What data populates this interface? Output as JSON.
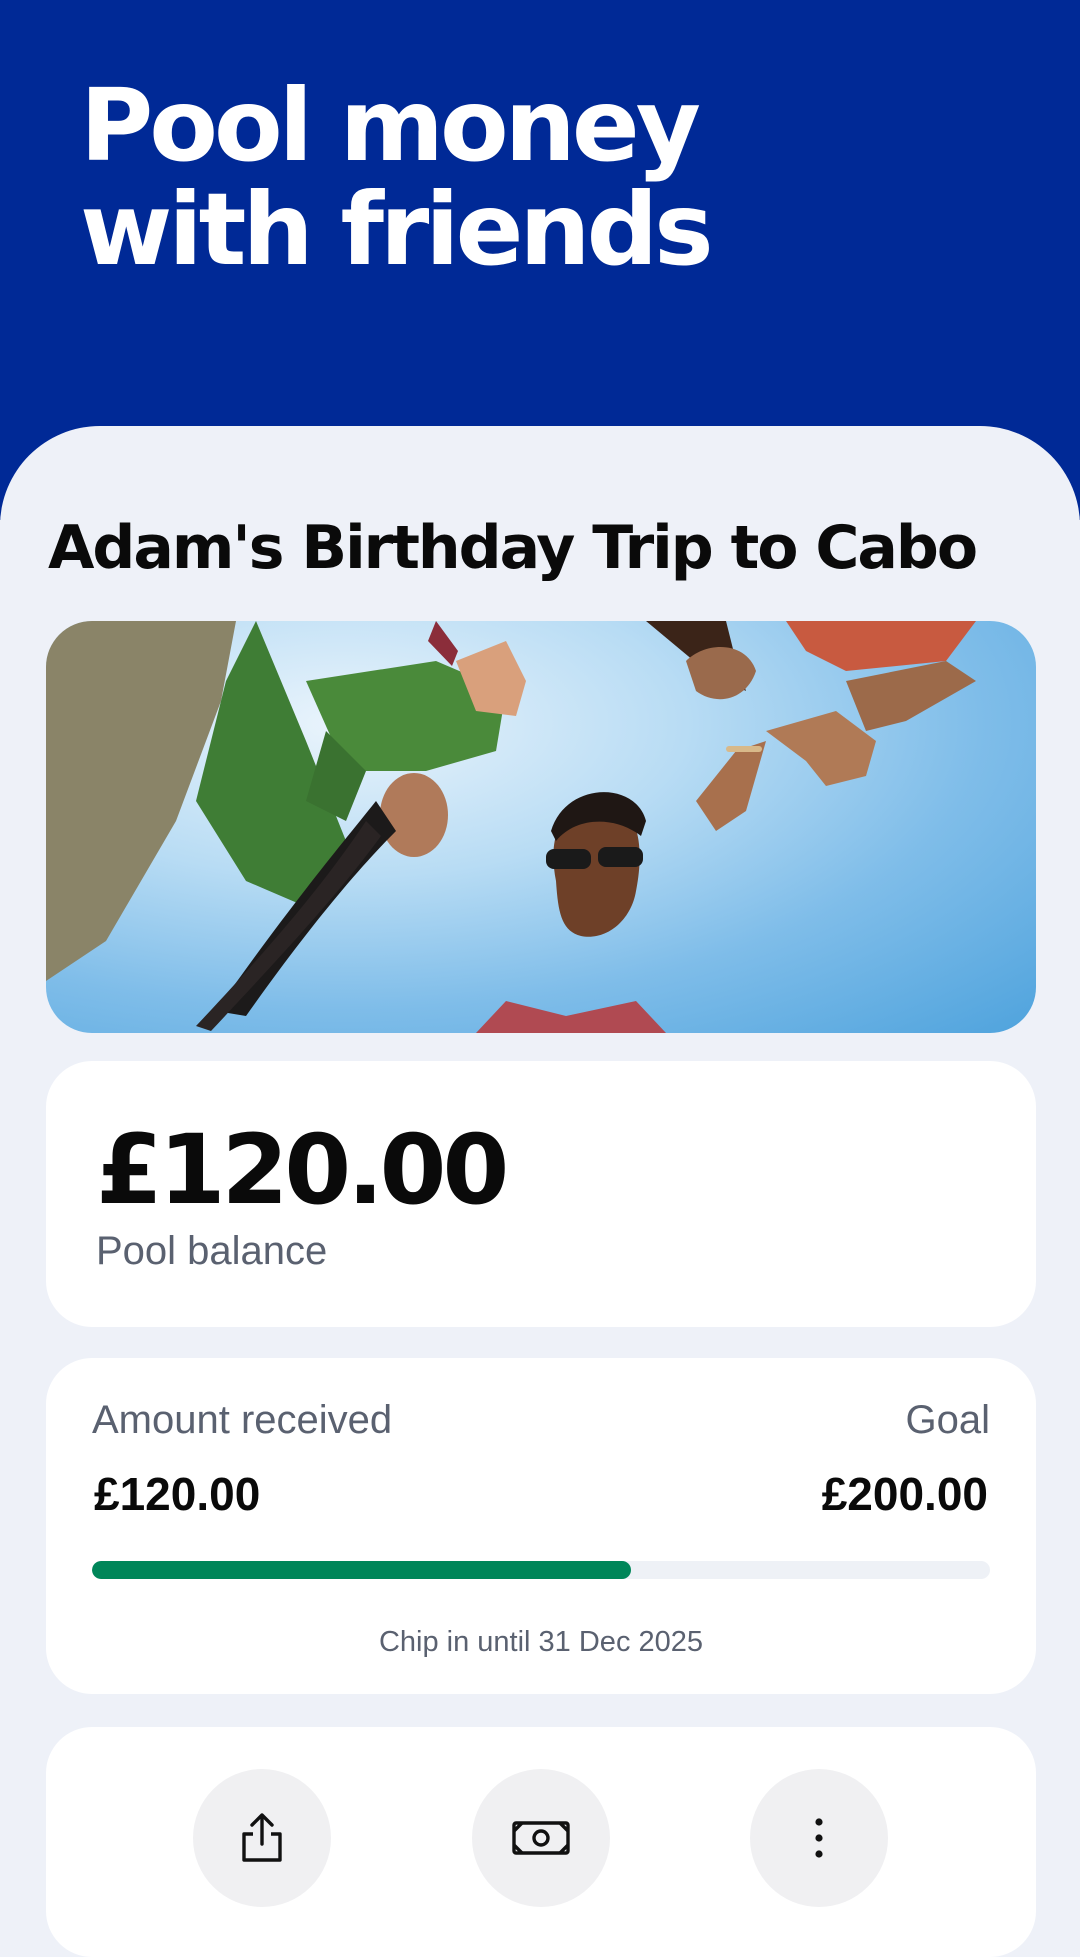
{
  "hero": {
    "title": "Pool money with friends"
  },
  "pool": {
    "name": "Adam's Birthday Trip to Cabo",
    "image_icon": "group-of-friends-photo",
    "balance": "£120.00",
    "balance_label": "Pool balance"
  },
  "goal": {
    "received_label": "Amount received",
    "received_value": "£120.00",
    "goal_label": "Goal",
    "goal_value": "£200.00",
    "progress_fraction": 0.6,
    "deadline": "Chip in until 31 Dec 2025"
  },
  "actions": [
    {
      "icon": "share-icon"
    },
    {
      "icon": "cash-icon"
    },
    {
      "icon": "more-vertical-icon"
    }
  ],
  "colors": {
    "brand_blue": "#002996",
    "background": "#eef1f8",
    "progress_green": "#008659",
    "secondary_text": "#5a6170"
  }
}
